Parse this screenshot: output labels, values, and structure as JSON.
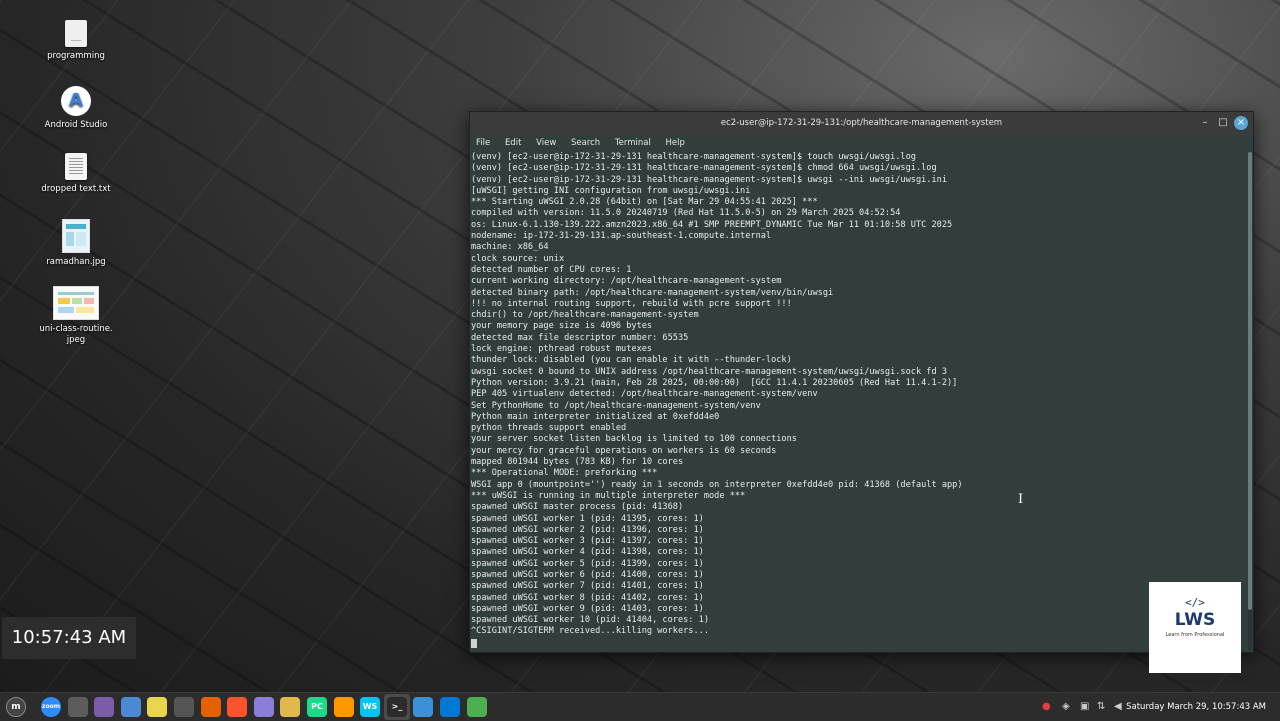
{
  "desktop": {
    "icons": [
      {
        "label": "programming"
      },
      {
        "label": "Android Studio"
      },
      {
        "label": "dropped text.txt"
      },
      {
        "label": "ramadhan.jpg"
      },
      {
        "label": "uni-class-routine.\njpeg"
      }
    ],
    "clock": "10:57:43 AM"
  },
  "terminal": {
    "title": "ec2-user@ip-172-31-29-131:/opt/healthcare-management-system",
    "menu": [
      "File",
      "Edit",
      "View",
      "Search",
      "Terminal",
      "Help"
    ],
    "lines": [
      "(venv) [ec2-user@ip-172-31-29-131 healthcare-management-system]$ touch uwsgi/uwsgi.log",
      "(venv) [ec2-user@ip-172-31-29-131 healthcare-management-system]$ chmod 664 uwsgi/uwsgi.log",
      "(venv) [ec2-user@ip-172-31-29-131 healthcare-management-system]$ uwsgi --ini uwsgi/uwsgi.ini",
      "[uWSGI] getting INI configuration from uwsgi/uwsgi.ini",
      "*** Starting uWSGI 2.0.28 (64bit) on [Sat Mar 29 04:55:41 2025] ***",
      "compiled with version: 11.5.0 20240719 (Red Hat 11.5.0-5) on 29 March 2025 04:52:54",
      "os: Linux-6.1.130-139.222.amzn2023.x86_64 #1 SMP PREEMPT_DYNAMIC Tue Mar 11 01:10:58 UTC 2025",
      "nodename: ip-172-31-29-131.ap-southeast-1.compute.internal",
      "machine: x86_64",
      "clock source: unix",
      "detected number of CPU cores: 1",
      "current working directory: /opt/healthcare-management-system",
      "detected binary path: /opt/healthcare-management-system/venv/bin/uwsgi",
      "!!! no internal routing support, rebuild with pcre support !!!",
      "chdir() to /opt/healthcare-management-system",
      "your memory page size is 4096 bytes",
      "detected max file descriptor number: 65535",
      "lock engine: pthread robust mutexes",
      "thunder lock: disabled (you can enable it with --thunder-lock)",
      "uwsgi socket 0 bound to UNIX address /opt/healthcare-management-system/uwsgi/uwsgi.sock fd 3",
      "Python version: 3.9.21 (main, Feb 28 2025, 00:00:00)  [GCC 11.4.1 20230605 (Red Hat 11.4.1-2)]",
      "PEP 405 virtualenv detected: /opt/healthcare-management-system/venv",
      "Set PythonHome to /opt/healthcare-management-system/venv",
      "Python main interpreter initialized at 0xefdd4e0",
      "python threads support enabled",
      "your server socket listen backlog is limited to 100 connections",
      "your mercy for graceful operations on workers is 60 seconds",
      "mapped 801944 bytes (783 KB) for 10 cores",
      "*** Operational MODE: preforking ***",
      "WSGI app 0 (mountpoint='') ready in 1 seconds on interpreter 0xefdd4e0 pid: 41368 (default app)",
      "*** uWSGI is running in multiple interpreter mode ***",
      "spawned uWSGI master process (pid: 41368)",
      "spawned uWSGI worker 1 (pid: 41395, cores: 1)",
      "spawned uWSGI worker 2 (pid: 41396, cores: 1)",
      "spawned uWSGI worker 3 (pid: 41397, cores: 1)",
      "spawned uWSGI worker 4 (pid: 41398, cores: 1)",
      "spawned uWSGI worker 5 (pid: 41399, cores: 1)",
      "spawned uWSGI worker 6 (pid: 41400, cores: 1)",
      "spawned uWSGI worker 7 (pid: 41401, cores: 1)",
      "spawned uWSGI worker 8 (pid: 41402, cores: 1)",
      "spawned uWSGI worker 9 (pid: 41403, cores: 1)",
      "spawned uWSGI worker 10 (pid: 41404, cores: 1)",
      "^CSIGINT/SIGTERM received...killing workers..."
    ]
  },
  "watermark": {
    "code": "</>",
    "name": "LWS",
    "tagline": "Learn from Professional"
  },
  "taskbar": {
    "apps": [
      {
        "icon": "zoom-icon",
        "text": "zoom",
        "color": "#2d8cff"
      },
      {
        "icon": "app-grid-icon",
        "text": "",
        "color": "#5c5c5c"
      },
      {
        "icon": "media-icon",
        "text": "",
        "color": "#7a5ca8"
      },
      {
        "icon": "camera-icon",
        "text": "",
        "color": "#4a8ad4"
      },
      {
        "icon": "sticky-notes-icon",
        "text": "",
        "color": "#e8d44d"
      },
      {
        "icon": "calculator-icon",
        "text": "",
        "color": "#555555"
      },
      {
        "icon": "firefox-icon",
        "text": "",
        "color": "#e66000"
      },
      {
        "icon": "brave-icon",
        "text": "",
        "color": "#fb542b"
      },
      {
        "icon": "notes-icon",
        "text": "",
        "color": "#8a7fd6"
      },
      {
        "icon": "files-icon",
        "text": "",
        "color": "#e0b84c"
      },
      {
        "icon": "pycharm-icon",
        "text": "PC",
        "color": "#21d789"
      },
      {
        "icon": "sublime-icon",
        "text": "",
        "color": "#ff9800"
      },
      {
        "icon": "webstorm-icon",
        "text": "WS",
        "color": "#07c3f2"
      },
      {
        "icon": "terminal-icon",
        "text": ">_",
        "color": "#2b2b2b"
      },
      {
        "icon": "kde-connect-icon",
        "text": "",
        "color": "#3d8fd6"
      },
      {
        "icon": "vscode-icon",
        "text": "",
        "color": "#0078d4"
      },
      {
        "icon": "chrome-icon",
        "text": "",
        "color": "#4caf50"
      }
    ],
    "datetime": "Saturday March 29, 10:57:43 AM"
  }
}
